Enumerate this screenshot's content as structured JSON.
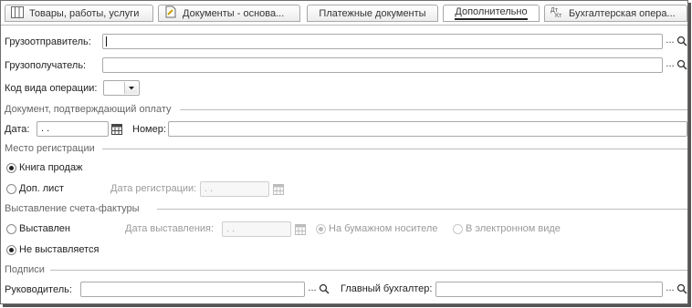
{
  "tabs": [
    {
      "label": "Товары, работы, услуги",
      "icon": "table-icon",
      "active": false
    },
    {
      "label": "Документы - основа...",
      "icon": "document-icon",
      "active": false
    },
    {
      "label": "Платежные документы",
      "icon": "",
      "active": false
    },
    {
      "label": "Дополнительно",
      "icon": "",
      "active": true
    },
    {
      "label": "Бухгалтерская опера...",
      "icon": "accounting-entry-icon",
      "active": false
    }
  ],
  "shipper": {
    "label": "Грузоотправитель:",
    "value": ""
  },
  "consignee": {
    "label": "Грузополучатель:",
    "value": ""
  },
  "operation_code": {
    "label": "Код вида операции:",
    "value": ""
  },
  "payment_doc": {
    "group_title": "Документ, подтверждающий оплату",
    "date_label": "Дата:",
    "date_value": " .  .",
    "number_label": "Номер:",
    "number_value": ""
  },
  "registration": {
    "group_title": "Место регистрации",
    "option_book": "Книга продаж",
    "option_extra": "Доп. лист",
    "reg_date_label": "Дата регистрации:",
    "reg_date_value": " .  .",
    "selected": "book"
  },
  "invoice": {
    "group_title": "Выставление счета-фактуры",
    "option_issued": "Выставлен",
    "issue_date_label": "Дата выставления:",
    "issue_date_value": " .  .",
    "option_paper": "На бумажном носителе",
    "option_electronic": "В электронном виде",
    "option_not_issued": "Не выставляется",
    "selected": "not_issued",
    "medium_selected": "paper"
  },
  "signatures": {
    "group_title": "Подписи",
    "head_label": "Руководитель:",
    "head_value": "",
    "accountant_label": "Главный бухгалтер:",
    "accountant_value": ""
  },
  "buttons": {
    "select_dots": "..."
  }
}
